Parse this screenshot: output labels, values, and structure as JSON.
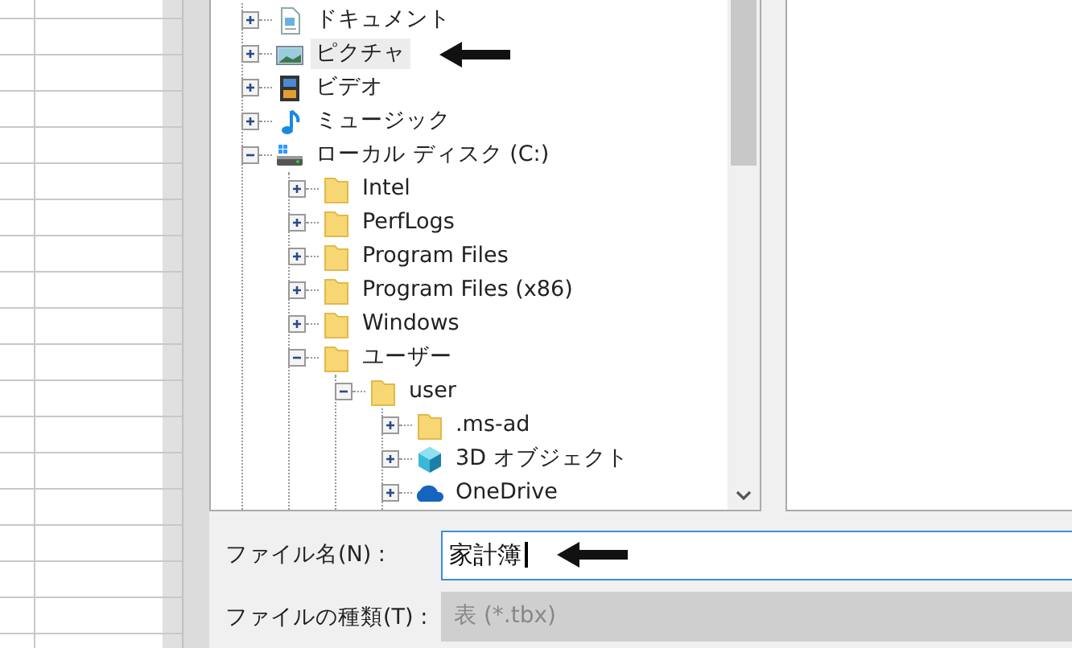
{
  "folder_tree": [
    {
      "label": "ドキュメント",
      "kind": "document",
      "expanded": false,
      "selected": false
    },
    {
      "label": "ピクチャ",
      "kind": "picture",
      "expanded": false,
      "selected": true
    },
    {
      "label": "ビデオ",
      "kind": "video",
      "expanded": false,
      "selected": false
    },
    {
      "label": "ミュージック",
      "kind": "music",
      "expanded": false,
      "selected": false
    },
    {
      "label": "ローカル ディスク (C:)",
      "kind": "drive",
      "expanded": true,
      "selected": false,
      "children": [
        {
          "label": "Intel",
          "kind": "folder",
          "expanded": false,
          "selected": false
        },
        {
          "label": "PerfLogs",
          "kind": "folder",
          "expanded": false,
          "selected": false
        },
        {
          "label": "Program Files",
          "kind": "folder",
          "expanded": false,
          "selected": false
        },
        {
          "label": "Program Files (x86)",
          "kind": "folder",
          "expanded": false,
          "selected": false
        },
        {
          "label": "Windows",
          "kind": "folder",
          "expanded": false,
          "selected": false
        },
        {
          "label": "ユーザー",
          "kind": "folder",
          "expanded": true,
          "selected": false,
          "children": [
            {
              "label": "user",
              "kind": "folder",
              "expanded": true,
              "selected": false,
              "children": [
                {
                  "label": ".ms-ad",
                  "kind": "folder",
                  "expanded": false,
                  "selected": false
                },
                {
                  "label": "3D オブジェクト",
                  "kind": "cube",
                  "expanded": false,
                  "selected": false
                },
                {
                  "label": "OneDrive",
                  "kind": "cloud",
                  "expanded": false,
                  "selected": false
                }
              ]
            }
          ]
        }
      ]
    }
  ],
  "file_name": {
    "label": "ファイル名(N) :",
    "value": "家計簿"
  },
  "file_type": {
    "label": "ファイルの種類(T) :",
    "value": "表 (*.tbx)",
    "disabled": true
  }
}
